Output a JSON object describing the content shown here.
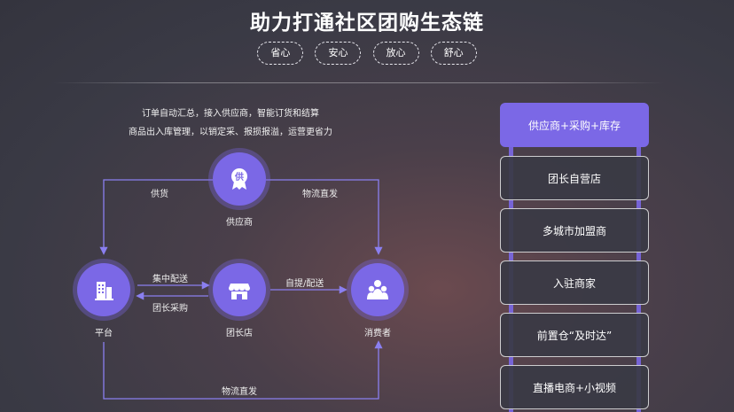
{
  "title": "助力打通社区团购生态链",
  "pills": [
    "省心",
    "安心",
    "放心",
    "舒心"
  ],
  "description": [
    "订单自动汇总，接入供应商，智能订货和结算",
    "商品出入库管理，以销定采、报损报溢，运营更省力"
  ],
  "nodes": {
    "supplier": "供应商",
    "platform": "平台",
    "leader_store": "团长店",
    "consumer": "消费者"
  },
  "node_badge_char": "供",
  "edges": {
    "supply": "供货",
    "direct_logistics_top": "物流直发",
    "central_delivery": "集中配送",
    "leader_purchase": "团长采购",
    "pickup_delivery": "自提/配送",
    "direct_logistics_bottom": "物流直发"
  },
  "ladder": [
    "供应商+采购+库存",
    "团长自营店",
    "多城市加盟商",
    "入驻商家",
    "前置仓“及时达”",
    "直播电商+小视频"
  ],
  "colors": {
    "accent": "#7b68e6",
    "line": "#8a7ff0"
  }
}
